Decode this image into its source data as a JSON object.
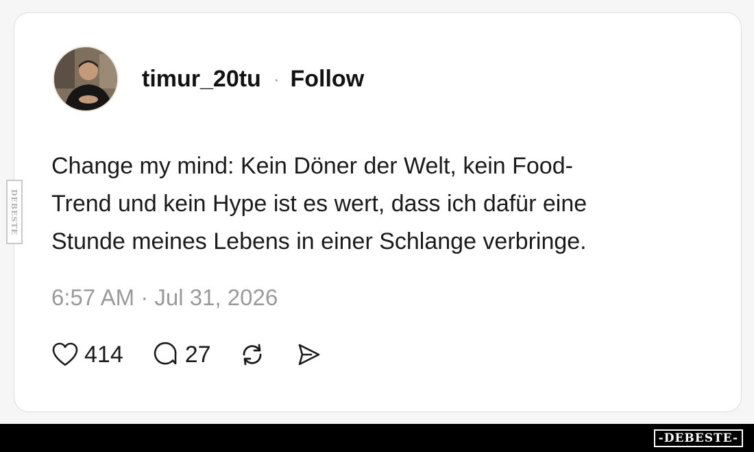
{
  "post": {
    "username": "timur_20tu",
    "separator": "·",
    "follow_label": "Follow",
    "text_lines": [
      "Change my mind: Kein Döner der Welt, kein Food-",
      "Trend und kein Hype ist es wert, dass ich dafür eine",
      "Stunde meines Lebens in einer Schlange verbringe."
    ],
    "timestamp": "6:57 AM · Jul 31, 2026"
  },
  "actions": {
    "likes": "414",
    "replies": "27",
    "icons": [
      "heart-icon",
      "comment-icon",
      "repost-icon",
      "share-icon"
    ]
  },
  "watermark": {
    "side_text": "DEBESTE",
    "brand_text": "-DEBESTE-"
  },
  "colors": {
    "text": "#1a1a1a",
    "muted": "#9a9a9a",
    "card": "#ffffff",
    "footer": "#000000"
  }
}
